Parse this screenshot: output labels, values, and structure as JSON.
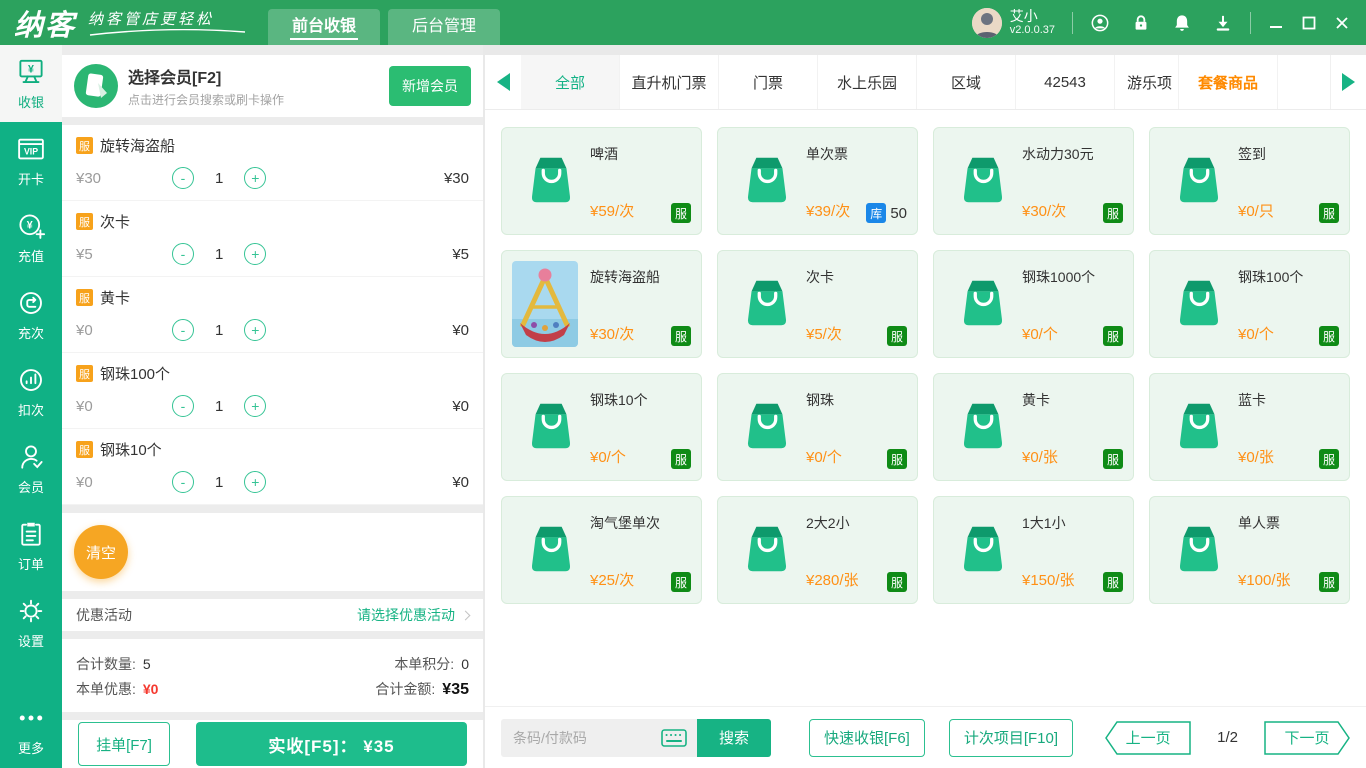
{
  "titlebar": {
    "logo": "纳客",
    "slogan": "纳客管店更轻松",
    "tabs": [
      {
        "label": "前台收银",
        "active": true
      },
      {
        "label": "后台管理",
        "active": false
      }
    ],
    "user": {
      "name": "艾小",
      "version": "v2.0.0.37"
    },
    "icons": [
      "customer-service",
      "lock",
      "bell",
      "download"
    ]
  },
  "sidebar": {
    "items": [
      {
        "label": "收银",
        "icon": "cashier",
        "active": true
      },
      {
        "label": "开卡",
        "icon": "vip-card",
        "active": false
      },
      {
        "label": "充值",
        "icon": "recharge",
        "active": false
      },
      {
        "label": "充次",
        "icon": "recharge-times",
        "active": false
      },
      {
        "label": "扣次",
        "icon": "deduct-times",
        "active": false
      },
      {
        "label": "会员",
        "icon": "member",
        "active": false
      },
      {
        "label": "订单",
        "icon": "orders",
        "active": false
      },
      {
        "label": "设置",
        "icon": "settings",
        "active": false
      },
      {
        "label": "更多",
        "icon": "more",
        "active": false
      }
    ]
  },
  "member_panel": {
    "title": "选择会员[F2]",
    "subtitle": "点击进行会员搜索或刷卡操作",
    "add_button": "新增会员"
  },
  "cart": {
    "items": [
      {
        "badge": "服",
        "name": "旋转海盗船",
        "unit_price": "¥30",
        "qty": "1",
        "amount": "¥30"
      },
      {
        "badge": "服",
        "name": "次卡",
        "unit_price": "¥5",
        "qty": "1",
        "amount": "¥5"
      },
      {
        "badge": "服",
        "name": "黄卡",
        "unit_price": "¥0",
        "qty": "1",
        "amount": "¥0"
      },
      {
        "badge": "服",
        "name": "钢珠100个",
        "unit_price": "¥0",
        "qty": "1",
        "amount": "¥0"
      },
      {
        "badge": "服",
        "name": "钢珠10个",
        "unit_price": "¥0",
        "qty": "1",
        "amount": "¥0"
      }
    ],
    "clear_button": "清空",
    "promo": {
      "label": "优惠活动",
      "value": "请选择优惠活动"
    },
    "summary": {
      "qty_label": "合计数量:",
      "qty_value": "5",
      "points_label": "本单积分:",
      "points_value": "0",
      "discount_label": "本单优惠:",
      "discount_value": "¥0",
      "total_label": "合计金额:",
      "total_value": "¥35"
    },
    "hold_button": "挂单[F7]",
    "pay_button": "实收[F5]： ¥35"
  },
  "categories": {
    "tabs": [
      {
        "label": "全部",
        "active": true
      },
      {
        "label": "直升机门票"
      },
      {
        "label": "门票"
      },
      {
        "label": "水上乐园"
      },
      {
        "label": "区域"
      },
      {
        "label": "42543"
      },
      {
        "label": "游乐项",
        "truncated": true
      },
      {
        "label": "套餐商品",
        "highlight": true
      }
    ]
  },
  "products": [
    {
      "name": "啤酒",
      "price": "¥59/次",
      "badge": "服"
    },
    {
      "name": "单次票",
      "price": "¥39/次",
      "badge": "库",
      "stock": "50"
    },
    {
      "name": "水动力30元",
      "price": "¥30/次",
      "badge": "服"
    },
    {
      "name": "签到",
      "price": "¥0/只",
      "badge": "服"
    },
    {
      "name": "旋转海盗船",
      "price": "¥30/次",
      "badge": "服",
      "photo": true
    },
    {
      "name": "次卡",
      "price": "¥5/次",
      "badge": "服"
    },
    {
      "name": "钢珠1000个",
      "price": "¥0/个",
      "badge": "服"
    },
    {
      "name": "钢珠100个",
      "price": "¥0/个",
      "badge": "服"
    },
    {
      "name": "钢珠10个",
      "price": "¥0/个",
      "badge": "服"
    },
    {
      "name": "钢珠",
      "price": "¥0/个",
      "badge": "服"
    },
    {
      "name": "黄卡",
      "price": "¥0/张",
      "badge": "服"
    },
    {
      "name": "蓝卡",
      "price": "¥0/张",
      "badge": "服"
    },
    {
      "name": "淘气堡单次",
      "price": "¥25/次",
      "badge": "服"
    },
    {
      "name": "2大2小",
      "price": "¥280/张",
      "badge": "服"
    },
    {
      "name": "1大1小",
      "price": "¥150/张",
      "badge": "服"
    },
    {
      "name": "单人票",
      "price": "¥100/张",
      "badge": "服"
    }
  ],
  "footer": {
    "search_placeholder": "条码/付款码",
    "search_button": "搜索",
    "quick_cashier_button": "快速收银[F6]",
    "count_item_button": "计次项目[F10]",
    "prev_button": "上一页",
    "page_indicator": "1/2",
    "next_button": "下一页"
  },
  "colors": {
    "topbar_green": "#2ca25e",
    "sidebar_green": "#10b185",
    "accent_green": "#17b384",
    "price_orange": "#ff9015",
    "service_badge_green": "#0f8b16",
    "stock_badge_blue": "#1a87e8",
    "cart_badge_orange": "#f7a21b",
    "clear_orange": "#f6a623",
    "discount_red": "#f5382e"
  }
}
